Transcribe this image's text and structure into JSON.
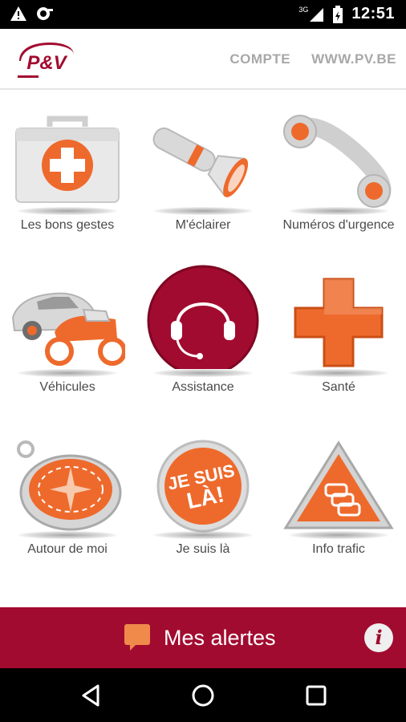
{
  "status_bar": {
    "time": "12:51",
    "network": "3G",
    "icons": [
      "warning-icon",
      "sync-icon",
      "signal-icon",
      "battery-icon"
    ]
  },
  "header": {
    "logo_text": "P&V",
    "nav": [
      "COMPTE",
      "WWW.PV.BE"
    ]
  },
  "tiles": [
    {
      "label": "Les bons gestes",
      "icon": "first-aid-kit-icon"
    },
    {
      "label": "M'éclairer",
      "icon": "flashlight-icon"
    },
    {
      "label": "Numéros d'urgence",
      "icon": "phone-handset-icon"
    },
    {
      "label": "Véhicules",
      "icon": "car-motorcycle-icon"
    },
    {
      "label": "Assistance",
      "icon": "headset-icon"
    },
    {
      "label": "Santé",
      "icon": "red-cross-icon"
    },
    {
      "label": "Autour de moi",
      "icon": "compass-icon"
    },
    {
      "label": "Je suis là",
      "icon": "je-suis-la-badge-icon",
      "badge_text": "JE SUIS LÀ!"
    },
    {
      "label": "Info trafic",
      "icon": "traffic-warning-icon"
    }
  ],
  "alerts_bar": {
    "title": "Mes alertes",
    "info_label": "i"
  },
  "colors": {
    "brand_red": "#a20b30",
    "accent_orange": "#ee6a2c",
    "nav_gray": "#a8a8a8"
  }
}
